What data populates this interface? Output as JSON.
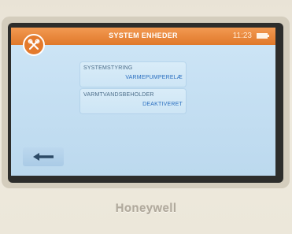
{
  "header": {
    "title": "SYSTEM ENHEDER",
    "time": "11:23",
    "tools_icon": "tools-icon",
    "battery_icon": "battery-icon"
  },
  "settings": [
    {
      "label": "SYSTEMSTYRING",
      "value": "VARMEPUMPERELÆ"
    },
    {
      "label": "VARMTVANDSBEHOLDER",
      "value": "DEAKTIVERET"
    }
  ],
  "navigation": {
    "back_icon": "back-arrow-icon"
  },
  "brand": {
    "name": "Honeywell"
  },
  "colors": {
    "accent": "#e47a2c",
    "screen_background": "#c6e0f3",
    "value_text": "#2a6fc0"
  }
}
